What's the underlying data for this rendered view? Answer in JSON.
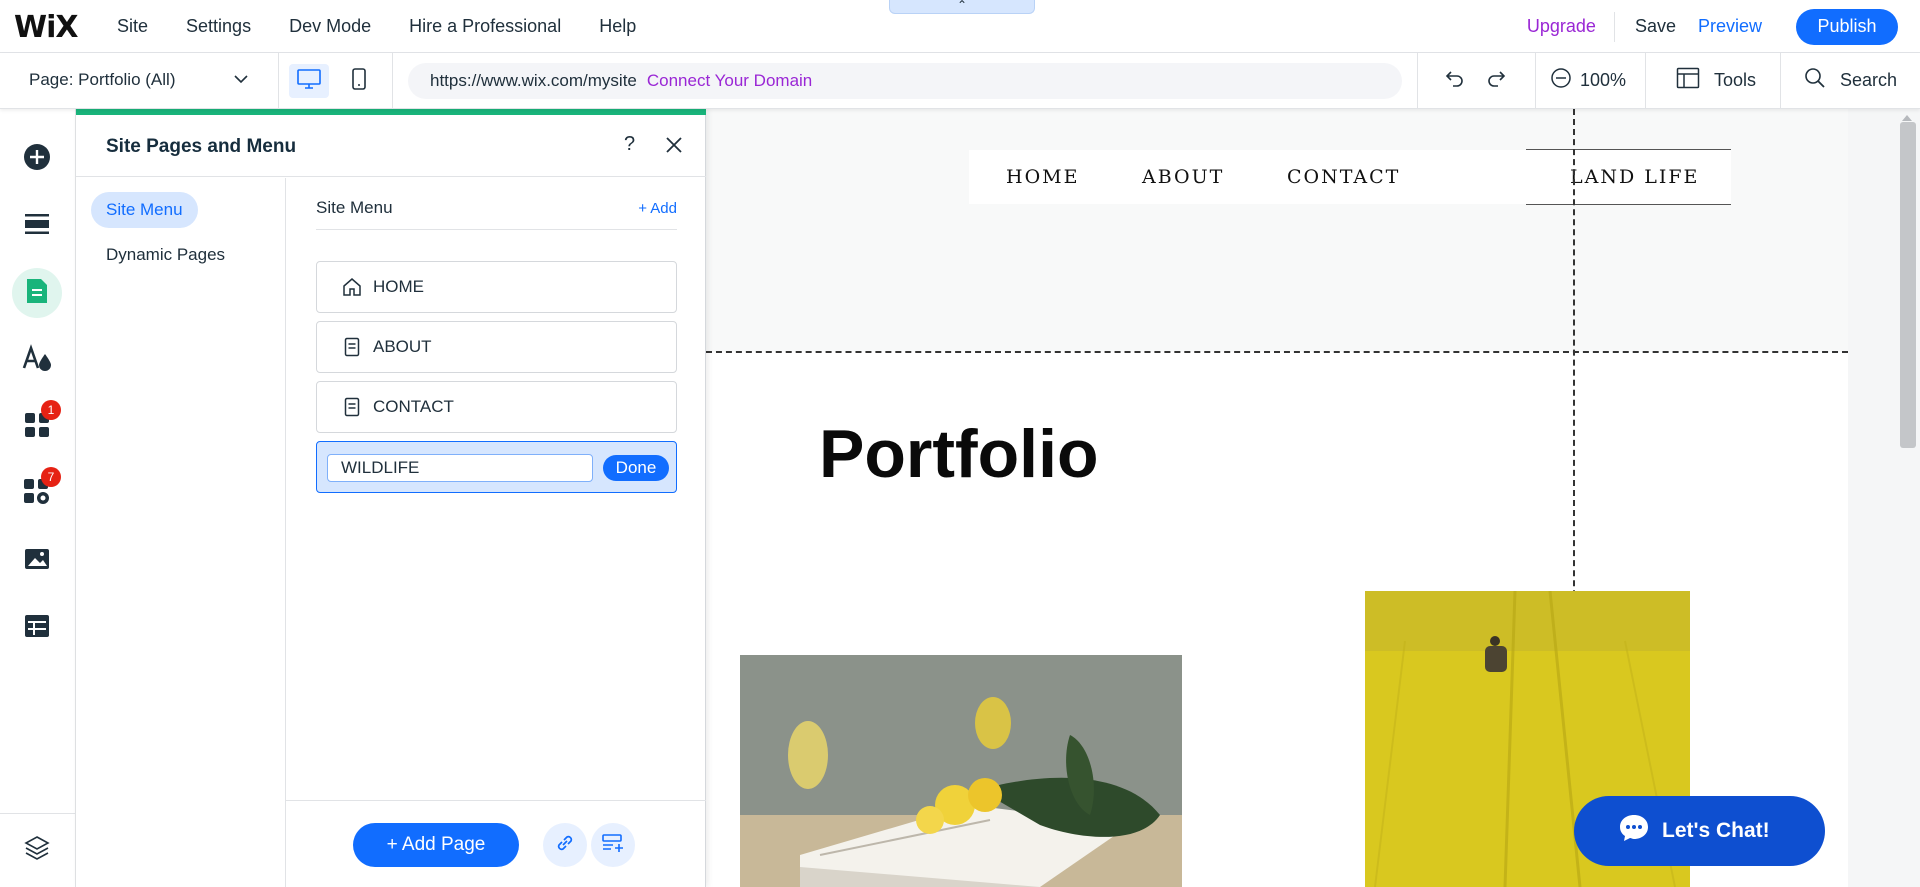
{
  "topbar": {
    "logo": "WiX",
    "menu": [
      "Site",
      "Settings",
      "Dev Mode",
      "Hire a Professional",
      "Help"
    ],
    "upgrade": "Upgrade",
    "save": "Save",
    "preview": "Preview",
    "publish": "Publish",
    "collapse_glyph": "⌃"
  },
  "toolbar": {
    "page_prefix": "Page:",
    "page_name": "Portfolio (All)",
    "url": "https://www.wix.com/mysite",
    "connect_domain": "Connect Your Domain",
    "zoom": "100%",
    "tools": "Tools",
    "search": "Search"
  },
  "leftbar": {
    "items": [
      {
        "icon": "plus-circle-icon"
      },
      {
        "icon": "sections-icon"
      },
      {
        "icon": "pages-icon",
        "active": true
      },
      {
        "icon": "design-icon"
      },
      {
        "icon": "apps-icon",
        "badge": "1"
      },
      {
        "icon": "business-icon",
        "badge": "7"
      },
      {
        "icon": "media-icon"
      },
      {
        "icon": "cms-icon"
      }
    ],
    "bottom": "layers-icon"
  },
  "panel": {
    "title": "Site Pages and Menu",
    "help": "?",
    "nav": [
      "Site Menu",
      "Dynamic Pages"
    ],
    "section_title": "Site Menu",
    "add_link": "+ Add",
    "items": [
      {
        "label": "HOME",
        "icon": "home-icon"
      },
      {
        "label": "ABOUT",
        "icon": "page-icon"
      },
      {
        "label": "CONTACT",
        "icon": "page-icon"
      }
    ],
    "edit_value": "WILDLIFE",
    "done": "Done",
    "add_page": "+ Add Page"
  },
  "canvas": {
    "nav": [
      "HOME",
      "ABOUT",
      "CONTACT",
      "LAND LIFE"
    ],
    "title": "Portfolio",
    "chat": "Let's Chat!"
  },
  "colors": {
    "accent": "#116dff",
    "panel_accent": "#19b47b",
    "upgrade": "#9a27d5",
    "badge": "#e62214",
    "chat": "#0e4fd0"
  }
}
